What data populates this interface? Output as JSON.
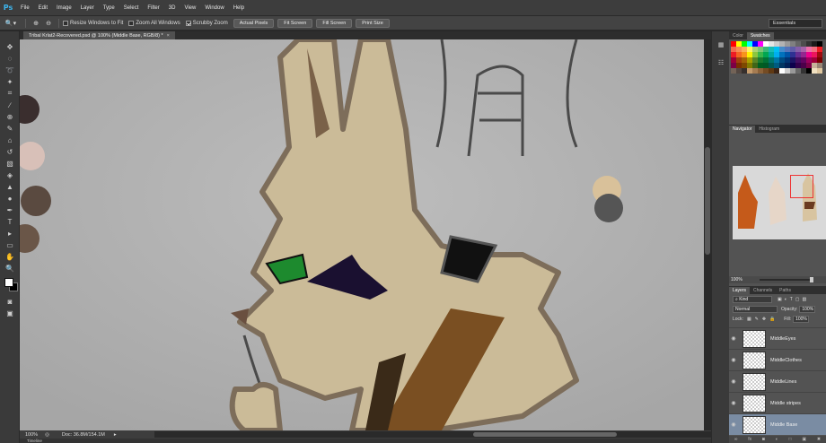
{
  "app": {
    "logo": "Ps"
  },
  "menu": [
    "File",
    "Edit",
    "Image",
    "Layer",
    "Type",
    "Select",
    "Filter",
    "3D",
    "View",
    "Window",
    "Help"
  ],
  "options": {
    "resize_windows": "Resize Windows to Fit",
    "zoom_all": "Zoom All Windows",
    "scrubby": "Scrubby Zoom",
    "actual_pixels": "Actual Pixels",
    "fit_screen": "Fit Screen",
    "fill_screen": "Fill Screen",
    "print_size": "Print Size",
    "workspace": "Essentials"
  },
  "document": {
    "tab_title": "Tribal Krlat2-Recovered.psd @ 100% (Middle Base, RGB/8) *",
    "zoom": "100%",
    "doc_size": "Doc: 36.8M/154.1M"
  },
  "timeline_label": "Timeline",
  "panels": {
    "color_tab": "Color",
    "swatches_tab": "Swatches",
    "navigator_tab": "Navigator",
    "histogram_tab": "Histogram",
    "navigator_zoom": "100%",
    "layers_tab": "Layers",
    "channels_tab": "Channels",
    "paths_tab": "Paths",
    "kind": "Kind",
    "blend_mode": "Normal",
    "opacity_label": "Opacity:",
    "opacity_value": "100%",
    "lock_label": "Lock:",
    "fill_label": "Fill:",
    "fill_value": "100%"
  },
  "layers": [
    {
      "name": "MiddleEyes",
      "selected": false
    },
    {
      "name": "MiddleClothes",
      "selected": false
    },
    {
      "name": "MiddleLines",
      "selected": false
    },
    {
      "name": "Middle stripes",
      "selected": false
    },
    {
      "name": "Middle Base",
      "selected": true
    }
  ],
  "swatch_colors": [
    "#ff0000",
    "#ffff00",
    "#00ff00",
    "#00ffff",
    "#0000ff",
    "#ff00ff",
    "#ffffff",
    "#e6e6e6",
    "#cccccc",
    "#b3b3b3",
    "#999999",
    "#808080",
    "#666666",
    "#4d4d4d",
    "#333333",
    "#1a1a1a",
    "#000000",
    "#f26c4f",
    "#f68e55",
    "#fbaf5c",
    "#fff467",
    "#acd372",
    "#7cc576",
    "#3bb878",
    "#1abbb4",
    "#00bff3",
    "#438ccb",
    "#5574b9",
    "#605ca8",
    "#855fa8",
    "#a763a9",
    "#ef6ea8",
    "#f16d7e",
    "#ee1d24",
    "#ed1c24",
    "#f26522",
    "#f7941d",
    "#fff200",
    "#8dc63f",
    "#39b54a",
    "#00a651",
    "#00a99d",
    "#00aeef",
    "#0072bc",
    "#0054a6",
    "#2e3192",
    "#662d91",
    "#92278f",
    "#ec008c",
    "#ed145b",
    "#9e0b0f",
    "#9e0039",
    "#a0410d",
    "#a36209",
    "#aba000",
    "#598527",
    "#1a7b30",
    "#007236",
    "#00746b",
    "#0076a3",
    "#004b80",
    "#003471",
    "#1b1464",
    "#440e62",
    "#630460",
    "#9e005d",
    "#9e0039",
    "#790000",
    "#7b0046",
    "#7b2e00",
    "#7d4900",
    "#827b00",
    "#406618",
    "#005e20",
    "#005826",
    "#005952",
    "#005b7f",
    "#003663",
    "#002157",
    "#0d004c",
    "#32004b",
    "#4b0049",
    "#7b0046",
    "#c7b299",
    "#998675",
    "#736357",
    "#534741",
    "#37302d",
    "#c69c6d",
    "#a67c52",
    "#8c6239",
    "#754c24",
    "#603913",
    "#3c2415",
    "#ffffff",
    "#cccccc",
    "#999999",
    "#666666",
    "#333333",
    "#000000",
    "#f0e0c0",
    "#e0c8a0"
  ]
}
